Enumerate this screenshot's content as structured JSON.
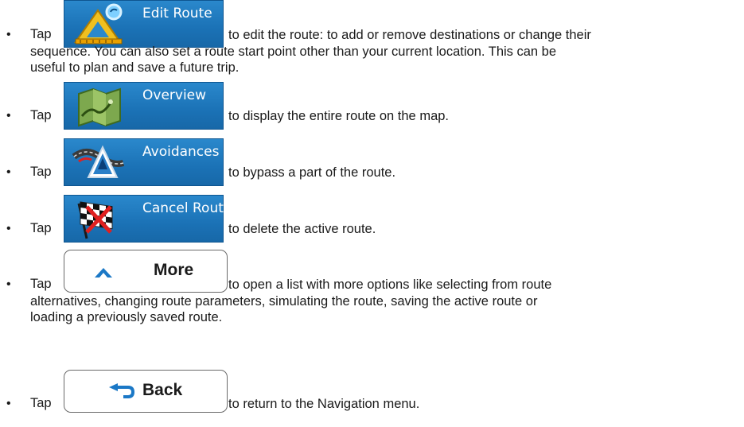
{
  "items": [
    {
      "bullet": "•",
      "tap": "Tap",
      "button_label": "Edit Route",
      "button_icon": "edit-route-icon",
      "description": "to edit the route: to add or remove destinations or change their",
      "continuation": [
        "sequence. You can also set a route start point other than your current location. This can be",
        "useful to plan and save a future trip."
      ]
    },
    {
      "bullet": "•",
      "tap": "Tap",
      "button_label": "Overview",
      "button_icon": "map-overview-icon",
      "description": "to display the entire route on the map."
    },
    {
      "bullet": "•",
      "tap": "Tap",
      "button_label": "Avoidances",
      "button_icon": "avoidances-icon",
      "description": "to bypass a part of the route."
    },
    {
      "bullet": "•",
      "tap": "Tap",
      "button_label": "Cancel Route",
      "button_icon": "checkered-flag-icon",
      "description": "to delete the active route."
    },
    {
      "bullet": "•",
      "tap": "Tap",
      "button_label": "More",
      "button_icon": "chevron-up-icon",
      "description": "to open a list with more options like selecting from route",
      "continuation": [
        "alternatives, changing route parameters, simulating the route, saving the active route or",
        "loading a previously saved route."
      ]
    },
    {
      "bullet": "•",
      "tap": "Tap",
      "button_label": "Back",
      "button_icon": "back-arrow-icon",
      "description": "to return to the Navigation menu."
    }
  ],
  "colors": {
    "button_blue": "#1b72b6",
    "button_icon_blue": "#1b78c6",
    "text": "#1a1a1a"
  }
}
